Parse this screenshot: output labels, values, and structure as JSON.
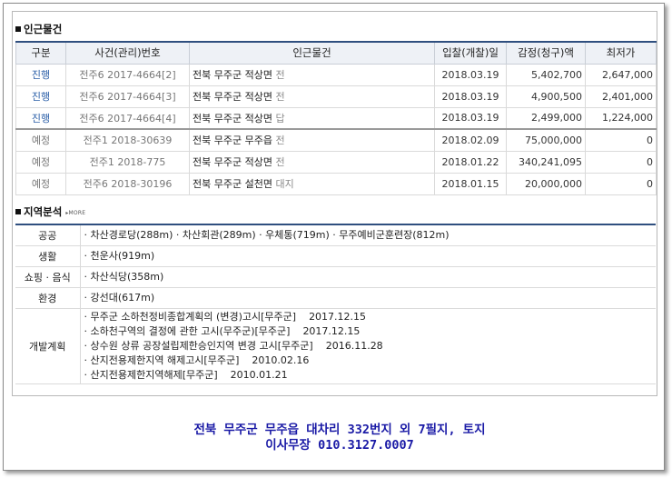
{
  "nearby": {
    "section_title": "인근물건",
    "headers": [
      "구분",
      "사건(관리)번호",
      "인근물건",
      "입찰(개찰)일",
      "감정(청구)액",
      "최저가"
    ],
    "rows": [
      {
        "status": "진행",
        "case": "전주6 2017-4664[2]",
        "prop": "전북 무주군 적상면",
        "type": "전",
        "date": "2018.03.19",
        "appraisal": "5,402,700",
        "min": "2,647,000"
      },
      {
        "status": "진행",
        "case": "전주6 2017-4664[3]",
        "prop": "전북 무주군 적상면",
        "type": "전",
        "date": "2018.03.19",
        "appraisal": "4,900,500",
        "min": "2,401,000"
      },
      {
        "status": "진행",
        "case": "전주6 2017-4664[4]",
        "prop": "전북 무주군 적상면",
        "type": "답",
        "date": "2018.03.19",
        "appraisal": "2,499,000",
        "min": "1,224,000"
      },
      {
        "status": "예정",
        "case": "전주1 2018-30639",
        "prop": "전북 무주군 무주읍",
        "type": "전",
        "date": "2018.02.09",
        "appraisal": "75,000,000",
        "min": "0"
      },
      {
        "status": "예정",
        "case": "전주1 2018-775",
        "prop": "전북 무주군 적상면",
        "type": "전",
        "date": "2018.01.22",
        "appraisal": "340,241,095",
        "min": "0"
      },
      {
        "status": "예정",
        "case": "전주6 2018-30196",
        "prop": "전북 무주군 설천면",
        "type": "대지",
        "date": "2018.01.15",
        "appraisal": "20,000,000",
        "min": "0"
      }
    ]
  },
  "region": {
    "section_title": "지역분석",
    "more_label": "MORE",
    "rows": [
      {
        "label": "공공",
        "value": "· 차산경로당(288m) · 차산회관(289m) · 우체통(719m) · 무주예비군훈련장(812m)"
      },
      {
        "label": "생활",
        "value": "· 천운사(919m)"
      },
      {
        "label": "쇼핑 · 음식",
        "value": "· 차산식당(358m)"
      },
      {
        "label": "환경",
        "value": "· 강선대(617m)"
      }
    ],
    "dev_label": "개발계획",
    "dev_items": [
      {
        "text": "· 무주군 소하천정비종합계획의 (변경)고시[무주군]",
        "date": "2017.12.15"
      },
      {
        "text": "· 소하천구역의 결정에 관한 고시(무주군)[무주군]",
        "date": "2017.12.15"
      },
      {
        "text": "· 상수원 상류 공장설립제한승인지역 변경 고시[무주군]",
        "date": "2016.11.28"
      },
      {
        "text": "· 산지전용제한지역 해제고시[무주군]",
        "date": "2010.02.16"
      },
      {
        "text": "· 산지전용제한지역해제[무주군]",
        "date": "2010.01.21"
      }
    ]
  },
  "footer": {
    "line1": "전북 무주군 무주읍 대차리 332번지 외 7필지, 토지",
    "line2": "이사무장 010.3127.0007"
  },
  "colors": {
    "header_bar": "#2f4f7f",
    "status_active": "#2b5fa8",
    "footer_text": "#1a1aa6"
  }
}
